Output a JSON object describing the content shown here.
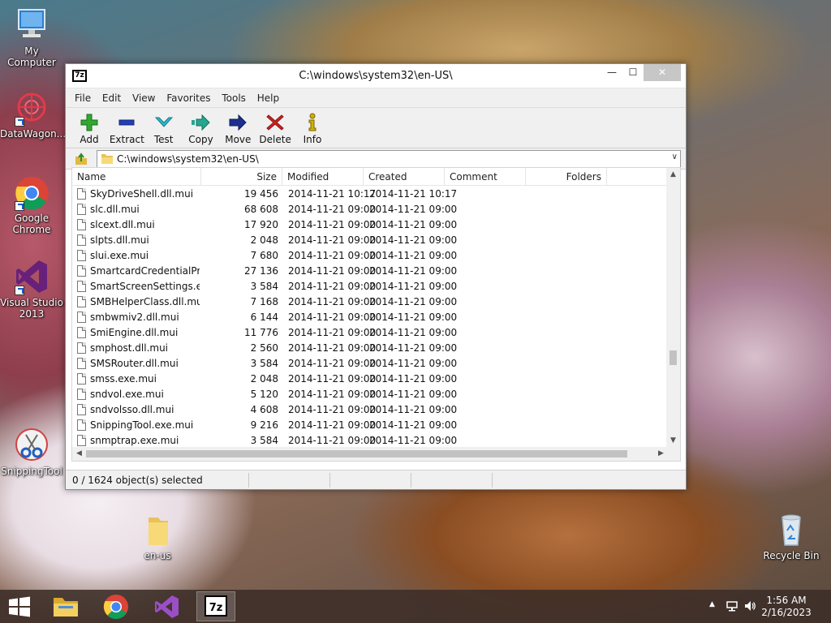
{
  "desktop": {
    "icons": [
      {
        "label": "My Computer"
      },
      {
        "label": "DataWagon..."
      },
      {
        "label": "Google Chrome"
      },
      {
        "label": "Visual Studio 2013"
      },
      {
        "label": "SnippingTool"
      },
      {
        "label": "en-us"
      },
      {
        "label": "Recycle Bin"
      }
    ]
  },
  "window": {
    "app_icon_text": "7z",
    "title": "C:\\windows\\system32\\en-US\\",
    "controls": {
      "minimize": "—",
      "maximize": "☐",
      "close": "✕"
    }
  },
  "menubar": {
    "items": [
      "File",
      "Edit",
      "View",
      "Favorites",
      "Tools",
      "Help"
    ]
  },
  "toolbar": {
    "buttons": [
      {
        "label": "Add",
        "icon": "plus-icon",
        "color": "#2fa82f"
      },
      {
        "label": "Extract",
        "icon": "minus-icon",
        "color": "#1f3fb4"
      },
      {
        "label": "Test",
        "icon": "check-chevron-icon",
        "color": "#2bb7c9"
      },
      {
        "label": "Copy",
        "icon": "double-arrow-right-icon",
        "color": "#27a58f"
      },
      {
        "label": "Move",
        "icon": "arrow-right-icon",
        "color": "#1c2f8f"
      },
      {
        "label": "Delete",
        "icon": "x-icon",
        "color": "#d0211e"
      },
      {
        "label": "Info",
        "icon": "info-icon",
        "color": "#d4b000"
      }
    ]
  },
  "address": {
    "path": "C:\\windows\\system32\\en-US\\"
  },
  "columns": {
    "name": "Name",
    "size": "Size",
    "modified": "Modified",
    "created": "Created",
    "comment": "Comment",
    "folders": "Folders"
  },
  "files": [
    {
      "name": "SkyDriveShell.dll.mui",
      "size": "19 456",
      "modified": "2014-11-21 10:17",
      "created": "2014-11-21 10:17"
    },
    {
      "name": "slc.dll.mui",
      "size": "68 608",
      "modified": "2014-11-21 09:00",
      "created": "2014-11-21 09:00"
    },
    {
      "name": "slcext.dll.mui",
      "size": "17 920",
      "modified": "2014-11-21 09:00",
      "created": "2014-11-21 09:00"
    },
    {
      "name": "slpts.dll.mui",
      "size": "2 048",
      "modified": "2014-11-21 09:00",
      "created": "2014-11-21 09:00"
    },
    {
      "name": "slui.exe.mui",
      "size": "7 680",
      "modified": "2014-11-21 09:00",
      "created": "2014-11-21 09:00"
    },
    {
      "name": "SmartcardCredentialPro...",
      "size": "27 136",
      "modified": "2014-11-21 09:00",
      "created": "2014-11-21 09:00"
    },
    {
      "name": "SmartScreenSettings.ex...",
      "size": "3 584",
      "modified": "2014-11-21 09:00",
      "created": "2014-11-21 09:00"
    },
    {
      "name": "SMBHelperClass.dll.mui",
      "size": "7 168",
      "modified": "2014-11-21 09:00",
      "created": "2014-11-21 09:00"
    },
    {
      "name": "smbwmiv2.dll.mui",
      "size": "6 144",
      "modified": "2014-11-21 09:00",
      "created": "2014-11-21 09:00"
    },
    {
      "name": "SmiEngine.dll.mui",
      "size": "11 776",
      "modified": "2014-11-21 09:00",
      "created": "2014-11-21 09:00"
    },
    {
      "name": "smphost.dll.mui",
      "size": "2 560",
      "modified": "2014-11-21 09:00",
      "created": "2014-11-21 09:00"
    },
    {
      "name": "SMSRouter.dll.mui",
      "size": "3 584",
      "modified": "2014-11-21 09:00",
      "created": "2014-11-21 09:00"
    },
    {
      "name": "smss.exe.mui",
      "size": "2 048",
      "modified": "2014-11-21 09:00",
      "created": "2014-11-21 09:00"
    },
    {
      "name": "sndvol.exe.mui",
      "size": "5 120",
      "modified": "2014-11-21 09:00",
      "created": "2014-11-21 09:00"
    },
    {
      "name": "sndvolsso.dll.mui",
      "size": "4 608",
      "modified": "2014-11-21 09:00",
      "created": "2014-11-21 09:00"
    },
    {
      "name": "SnippingTool.exe.mui",
      "size": "9 216",
      "modified": "2014-11-21 09:00",
      "created": "2014-11-21 09:00"
    },
    {
      "name": "snmptrap.exe.mui",
      "size": "3 584",
      "modified": "2014-11-21 09:00",
      "created": "2014-11-21 09:00"
    }
  ],
  "status": {
    "selection": "0 / 1624 object(s) selected"
  },
  "taskbar": {
    "clock_time": "1:56 AM",
    "clock_date": "2/16/2023"
  }
}
